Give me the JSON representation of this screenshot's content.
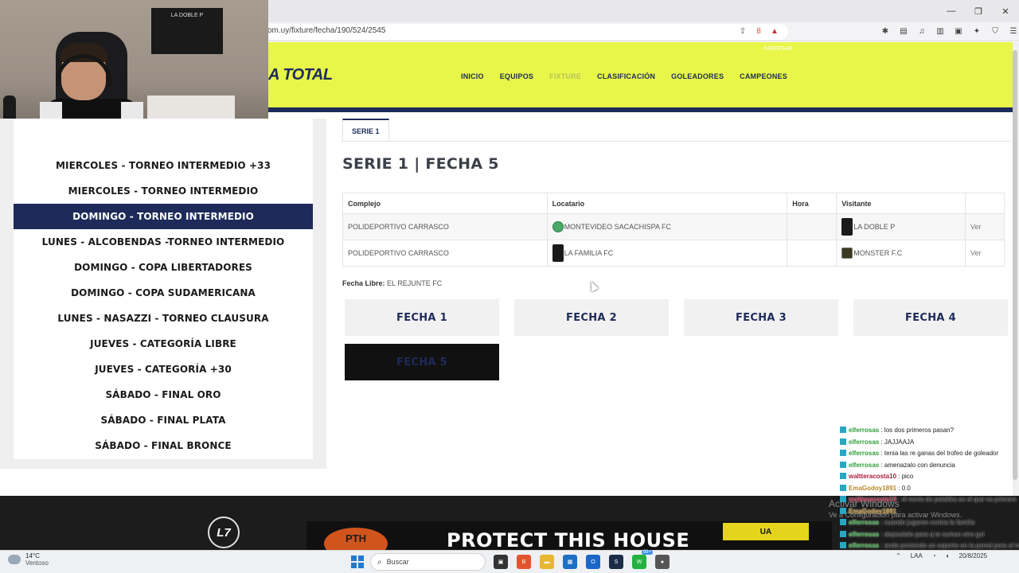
{
  "browser": {
    "url": "om.uy/fixture/fecha/190/524/2545",
    "wallet_badge": "8"
  },
  "site": {
    "brand": "A TOTAL",
    "header_tiny": "INGRESAR",
    "nav": [
      "INICIO",
      "EQUIPOS",
      "FIXTURE",
      "CLASIFICACIÓN",
      "GOLEADORES",
      "CAMPEONES"
    ]
  },
  "webcam": {
    "flag_text": "LA DOBLE P"
  },
  "sidebar": {
    "items": [
      "MIERCOLES - TORNEO INTERMEDIO +33",
      "MIERCOLES - TORNEO INTERMEDIO",
      "DOMINGO - TORNEO INTERMEDIO",
      "LUNES - ALCOBENDAS -TORNEO INTERMEDIO",
      "DOMINGO - COPA LIBERTADORES",
      "DOMINGO - COPA SUDAMERICANA",
      "LUNES - NASAZZI - TORNEO CLAUSURA",
      "JUEVES - CATEGORÍA LIBRE",
      "JUEVES - CATEGORÍA +30",
      "SÁBADO - FINAL ORO",
      "SÁBADO - FINAL PLATA",
      "SÁBADO - FINAL BRONCE"
    ],
    "active_index": 2
  },
  "main": {
    "tab": "SERIE 1",
    "title": "SERIE 1 | FECHA 5",
    "table": {
      "headers": [
        "Complejo",
        "Locatario",
        "Hora",
        "Visitante",
        ""
      ],
      "rows": [
        {
          "complejo": "POLIDEPORTIVO CARRASCO",
          "locatario": "MONTEVIDEO SACACHISPA FC",
          "hora": "",
          "visitante": "LA DOBLE P",
          "link": "Ver"
        },
        {
          "complejo": "POLIDEPORTIVO CARRASCO",
          "locatario": "LA FAMILIA FC",
          "hora": "",
          "visitante": "MONSTER F.C",
          "link": "Ver"
        }
      ]
    },
    "fecha_libre_label": "Fecha Libre:",
    "fecha_libre_value": "EL REJUNTE FC",
    "fechas": [
      "FECHA 1",
      "FECHA 2",
      "FECHA 3",
      "FECHA 4",
      "FECHA 5"
    ],
    "active_fecha": 4
  },
  "footer": {
    "logo": "L7",
    "banner_ball": "PTH",
    "banner_slogan": "PROTECT THIS HOUSE",
    "banner_badge": "UA"
  },
  "chat": [
    {
      "user": "elferrosas",
      "msg": ": los dos primeros pasan?"
    },
    {
      "user": "elferrosas",
      "msg": ": JAJJAAJA"
    },
    {
      "user": "elferrosas",
      "msg": ": tenia las re ganas del trofeo de goleador"
    },
    {
      "user": "elferrosas",
      "msg": ": amenazalo con denuncia"
    },
    {
      "user": "waltteracosta10",
      "msg": ": pico"
    },
    {
      "user": "EmaGodoy1891",
      "msg": ": 0.0"
    },
    {
      "user": "waltteracosta10",
      "msg": ": el novio de petakka es el que va primero"
    },
    {
      "user": "EmaGodoy1891",
      "msg": ":"
    },
    {
      "user": "elferrosas",
      "msg": ": cuando jugaron contra la familia"
    },
    {
      "user": "elferrosas",
      "msg": ": depositale para q te sumen otro gol"
    },
    {
      "user": "elferrosas",
      "msg": ": anda poniendo un soporte en la pared para el trofeo"
    }
  ],
  "chat_colors": {
    "elferrosas": "#2e9e3a",
    "waltteracosta10": "#b01a3c",
    "EmaGodoy1891": "#b8862a"
  },
  "activate_windows": {
    "title": "Activar Windows",
    "subtitle": "Ve a Configuración para activar Windows."
  },
  "taskbar": {
    "temp": "14°C",
    "weather": "Ventoso",
    "search": "Buscar",
    "badge": "99+",
    "lang": "LAA",
    "date": "20/8/2025"
  }
}
